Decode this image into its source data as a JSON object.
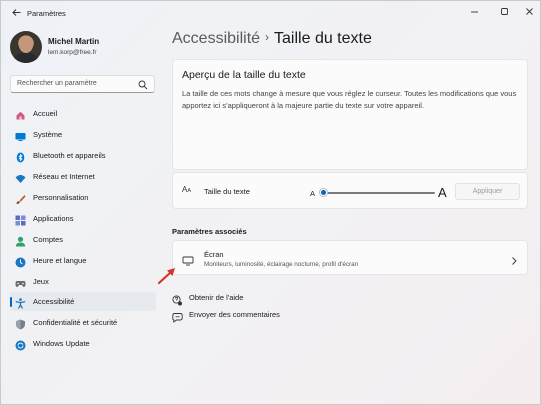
{
  "window": {
    "title": "Paramètres",
    "back_icon": "arrow-left-icon",
    "controls": [
      "minimize-icon",
      "maximize-icon",
      "close-icon"
    ]
  },
  "profile": {
    "name": "Michel Martin",
    "email": "lem.korp@free.fr"
  },
  "search": {
    "placeholder": "Rechercher un paramètre",
    "icon": "search-icon"
  },
  "sidebar": {
    "items": [
      {
        "label": "Accueil",
        "icon": "home-icon",
        "color": "#d05b7e"
      },
      {
        "label": "Système",
        "icon": "system-icon",
        "color": "#0078d4"
      },
      {
        "label": "Bluetooth et appareils",
        "icon": "bluetooth-icon",
        "color": "#0078d4"
      },
      {
        "label": "Réseau et Internet",
        "icon": "wifi-icon",
        "color": "#1a78c2"
      },
      {
        "label": "Personnalisation",
        "icon": "brush-icon",
        "color": "#c55a2a"
      },
      {
        "label": "Applications",
        "icon": "apps-icon",
        "color": "#5a6cbf"
      },
      {
        "label": "Comptes",
        "icon": "accounts-icon",
        "color": "#2da36a"
      },
      {
        "label": "Heure et langue",
        "icon": "time-language-icon",
        "color": "#1a78c2"
      },
      {
        "label": "Jeux",
        "icon": "gamepad-icon",
        "color": "#6b6b6b"
      },
      {
        "label": "Accessibilité",
        "icon": "accessibility-icon",
        "color": "#1a78c2",
        "active": true
      },
      {
        "label": "Confidentialité et sécurité",
        "icon": "shield-icon",
        "color": "#7a7f87"
      },
      {
        "label": "Windows Update",
        "icon": "windows-update-icon",
        "color": "#1a78c2"
      }
    ]
  },
  "breadcrumb": {
    "parent": "Accessibilité",
    "separator": "›",
    "current": "Taille du texte"
  },
  "preview": {
    "title": "Aperçu de la taille du texte",
    "body": "La taille de ces mots change à mesure que vous réglez le curseur. Toutes les modifications que vous apportez ici s'appliqueront à la majeure partie du texte sur votre appareil."
  },
  "text_size": {
    "icon": "text-size-icon",
    "icon_text_big": "A",
    "icon_text_small": "A",
    "label": "Taille du texte",
    "slider_min_label": "A",
    "slider_max_label": "A",
    "slider_value_fraction": 0.0,
    "apply_label": "Appliquer"
  },
  "related": {
    "heading": "Paramètres associés",
    "ecran": {
      "title": "Écran",
      "subtitle": "Moniteurs, luminosité, éclairage nocturne, profil d'écran",
      "icon": "monitor-icon"
    }
  },
  "links": {
    "help": "Obtenir de l'aide",
    "feedback": "Envoyer des commentaires"
  },
  "colors": {
    "accent": "#0067c0",
    "annotation_arrow": "#d9342b"
  }
}
